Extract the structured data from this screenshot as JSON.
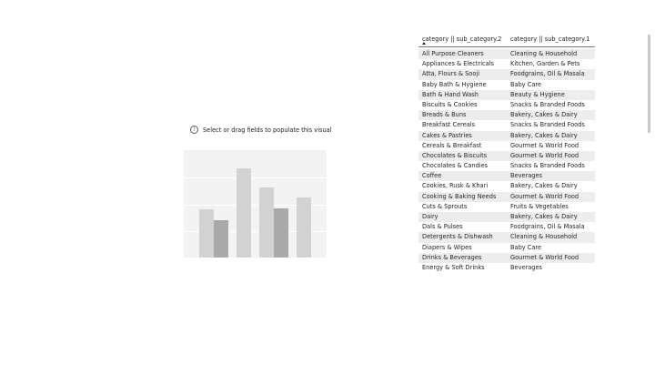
{
  "placeholder": {
    "hint": "Select or drag fields to populate this visual",
    "icon": "info-icon"
  },
  "table": {
    "columns": [
      "category || sub_category.2",
      "category || sub_category.1"
    ],
    "sort": "ascending",
    "rows": [
      [
        "All Purpose Cleaners",
        "Cleaning & Household"
      ],
      [
        "Appliances & Electricals",
        "Kitchen, Garden & Pets"
      ],
      [
        "Atta, Flours & Sooji",
        "Foodgrains, Oil & Masala"
      ],
      [
        "Baby Bath & Hygiene",
        "Baby Care"
      ],
      [
        "Bath & Hand Wash",
        "Beauty & Hygiene"
      ],
      [
        "Biscuits & Cookies",
        "Snacks & Branded Foods"
      ],
      [
        "Breads & Buns",
        "Bakery, Cakes & Dairy"
      ],
      [
        "Breakfast Cereals",
        "Snacks & Branded Foods"
      ],
      [
        "Cakes & Pastries",
        "Bakery, Cakes & Dairy"
      ],
      [
        "Cereals & Breakfast",
        "Gourmet & World Food"
      ],
      [
        "Chocolates & Biscuits",
        "Gourmet & World Food"
      ],
      [
        "Chocolates & Candies",
        "Snacks & Branded Foods"
      ],
      [
        "Coffee",
        "Beverages"
      ],
      [
        "Cookies, Rusk & Khari",
        "Bakery, Cakes & Dairy"
      ],
      [
        "Cooking & Baking Needs",
        "Gourmet & World Food"
      ],
      [
        "Cuts & Sprouts",
        "Fruits & Vegetables"
      ],
      [
        "Dairy",
        "Bakery, Cakes & Dairy"
      ],
      [
        "Dals & Pulses",
        "Foodgrains, Oil & Masala"
      ],
      [
        "Detergents & Dishwash",
        "Cleaning & Household"
      ],
      [
        "Diapers & Wipes",
        "Baby Care"
      ],
      [
        "Drinks & Beverages",
        "Gourmet & World Food"
      ],
      [
        "Energy & Soft Drinks",
        "Beverages"
      ]
    ]
  },
  "colors": {
    "header_underline": "#1f9ba8",
    "row_shade": "#efecee",
    "ghost_bg": "#f3f3f3",
    "ghost_bar_light": "#d2d2d2",
    "ghost_bar_dark": "#a9a9a9"
  }
}
